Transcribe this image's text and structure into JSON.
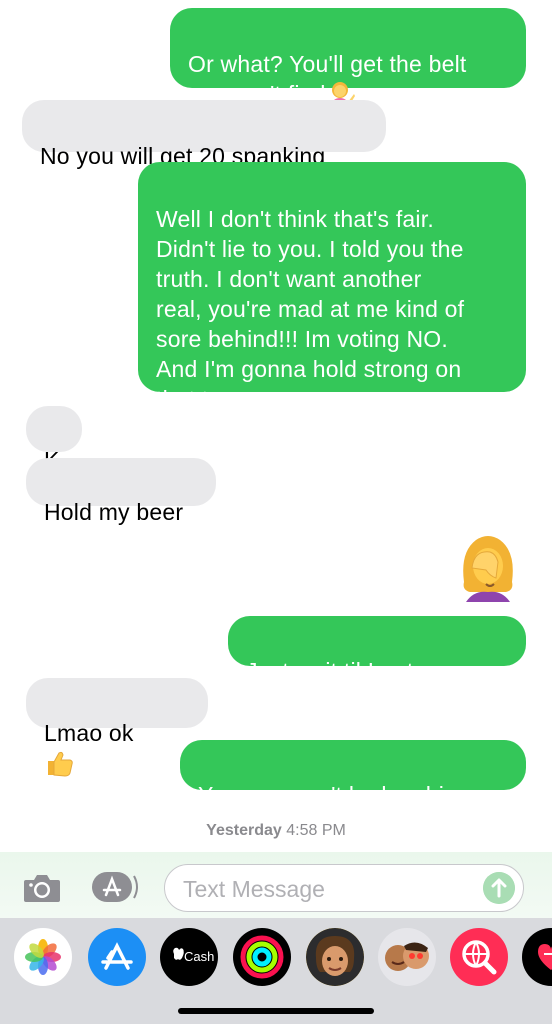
{
  "conversation": {
    "messages": [
      {
        "from": "me",
        "text": "Or what? You'll get the belt\nyou can't find",
        "emoji": "woman-tipping-hand"
      },
      {
        "from": "them",
        "text": "No you will get 20 spanking"
      },
      {
        "from": "me",
        "text": "Well I don't think that's fair.\nDidn't lie to you. I told you the\ntruth. I don't want another\nreal, you're mad at me kind of\nsore behind!!! Im voting NO.\nAnd I'm gonna hold strong on\nthat too."
      },
      {
        "from": "them",
        "text": "K"
      },
      {
        "from": "them",
        "text": "Hold my beer"
      },
      {
        "from": "me",
        "emoji_only": "woman-facepalming"
      },
      {
        "from": "me",
        "text": "Just wait til I get angry"
      },
      {
        "from": "them",
        "text": "Lmao  ok",
        "emoji": "thumbs-up"
      },
      {
        "from": "me",
        "text": "Yea you won't be laughing"
      }
    ],
    "timestamp_day": "Yesterday",
    "timestamp_time": "4:58 PM"
  },
  "composer": {
    "placeholder": "Text Message"
  },
  "app_tray": {
    "apps": [
      "photos-icon",
      "app-store-icon",
      "apple-cash-icon",
      "activity-icon",
      "memoji-icon",
      "memoji-stickers-icon",
      "web-search-icon",
      "digital-touch-icon"
    ],
    "cash_label": "Cash"
  },
  "colors": {
    "sent_bubble": "#34c759",
    "received_bubble": "#e9e9eb",
    "tray_background": "#d9dade"
  }
}
